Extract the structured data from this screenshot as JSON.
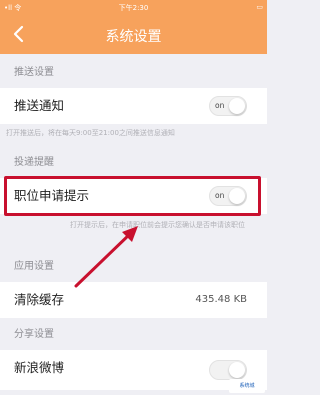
{
  "status_bar": {
    "carrier": "•ll 令",
    "time": "下午2:30",
    "battery": "▭"
  },
  "nav": {
    "title": "系统设置",
    "back_icon": "chevron-left-icon"
  },
  "sections": [
    {
      "header": "推送设置"
    },
    {
      "header": "投递提醒"
    },
    {
      "header": "应用设置"
    },
    {
      "header": "分享设置"
    }
  ],
  "rows": {
    "push": {
      "label": "推送通知",
      "toggle_text": "on",
      "hint": "打开推送后，将在每天9:00至21:00之间推送信息通知"
    },
    "job_prompt": {
      "label": "职位申请提示",
      "toggle_text": "on",
      "hint": "打开提示后，在申请职位前会提示您确认是否申请该职位"
    },
    "clear_cache": {
      "label": "清除缓存",
      "value": "435.48 KB"
    },
    "weibo": {
      "label": "新浪微博"
    }
  },
  "watermark": "系统城",
  "colors": {
    "accent": "#f7a25c",
    "highlight": "#c8102e"
  }
}
